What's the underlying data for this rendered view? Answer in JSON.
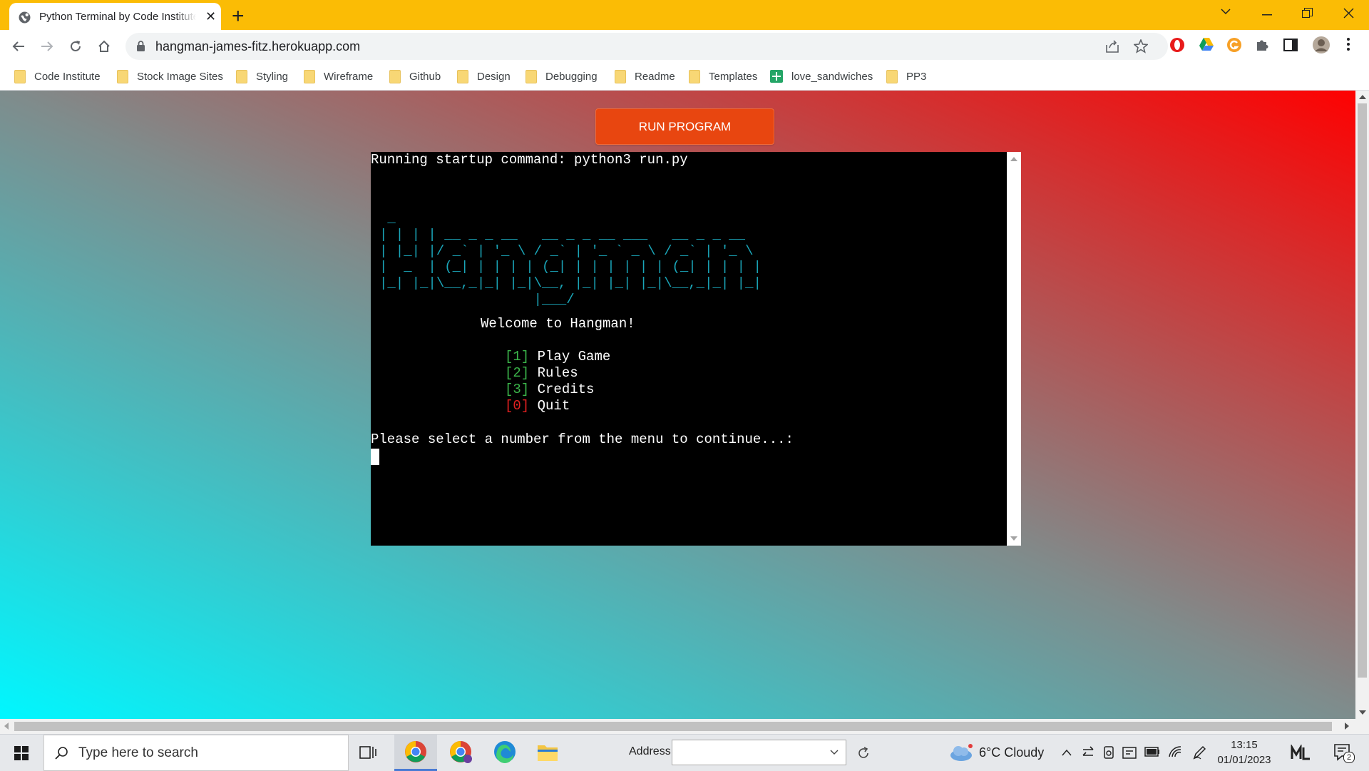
{
  "browser": {
    "tab_title": "Python Terminal by Code Institute",
    "tab_close": "✕",
    "new_tab": "+",
    "url": "hangman-james-fitz.herokuapp.com",
    "accent_color": "#fbbc05"
  },
  "bookmarks": [
    {
      "label": "Code Institute",
      "icon": "folder-icon"
    },
    {
      "label": "Stock Image Sites",
      "icon": "folder-icon"
    },
    {
      "label": "Styling",
      "icon": "folder-icon"
    },
    {
      "label": "Wireframe",
      "icon": "folder-icon"
    },
    {
      "label": "Github",
      "icon": "folder-icon"
    },
    {
      "label": "Design",
      "icon": "folder-icon"
    },
    {
      "label": "Debugging",
      "icon": "folder-icon"
    },
    {
      "label": "Readme",
      "icon": "folder-icon"
    },
    {
      "label": "Templates",
      "icon": "folder-icon"
    },
    {
      "label": "love_sandwiches",
      "icon": "sheets-icon"
    },
    {
      "label": "PP3",
      "icon": "folder-icon"
    }
  ],
  "page": {
    "run_button": "RUN PROGRAM",
    "button_color": "#e84610",
    "terminal": {
      "startup": "Running startup command: python3 run.py",
      "ascii_art": [
        " _",
        "| | | | __ _ _ __   __ _ _ __ ___   __ _ _ __",
        "| |_| |/ _` | '_ \\ / _` | '_ ` _ \\ / _` | '_ \\",
        "|  _  | (_| | | | | (_| | | | | | | (_| | | | |",
        "|_| |_|\\__,_|_| |_|\\__, |_| |_| |_|\\__,_|_| |_|",
        "                   |___/"
      ],
      "welcome": "Welcome to Hangman!",
      "menu": [
        {
          "num": "[1]",
          "label": "Play Game"
        },
        {
          "num": "[2]",
          "label": "Rules"
        },
        {
          "num": "[3]",
          "label": "Credits"
        },
        {
          "num": "[0]",
          "label": "Quit"
        }
      ],
      "prompt": "Please select a number from the menu to continue...:"
    }
  },
  "taskbar": {
    "search_placeholder": "Type here to search",
    "address_label": "Address",
    "weather": "6°C  Cloudy",
    "time": "13:15",
    "date": "01/01/2023",
    "notification_count": "2"
  }
}
